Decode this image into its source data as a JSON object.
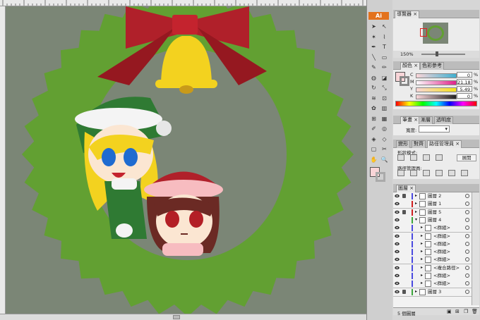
{
  "app": {
    "badge": "Ai"
  },
  "navigator": {
    "tab_label": "導覽器",
    "zoom": "150%"
  },
  "color_panel": {
    "tabs": [
      "顏色",
      "色彩參考"
    ],
    "channels": [
      {
        "label": "C",
        "value": "0",
        "unit": "%"
      },
      {
        "label": "M",
        "value": "21.18",
        "unit": "%"
      },
      {
        "label": "Y",
        "value": "5.49",
        "unit": "%"
      },
      {
        "label": "K",
        "value": "0",
        "unit": "%"
      }
    ],
    "fill_color": "#f9d5d8"
  },
  "stroke_panel": {
    "tabs": [
      "筆畫",
      "漸層",
      "透明度"
    ],
    "width_label": "寬度:"
  },
  "pathfinder_panel": {
    "tabs": [
      "變形",
      "對齊",
      "路徑管理員"
    ],
    "shape_modes_label": "形狀模式:",
    "expand_label": "展開",
    "pathfinders_label": "路徑管理員:"
  },
  "layers_panel": {
    "tab_label": "圖層",
    "footer_count": "5 個圖層",
    "rows": [
      {
        "name": "圖層 2",
        "color": "#4a4ae0",
        "locked": true,
        "indent": 0
      },
      {
        "name": "圖層 1",
        "color": "#d02020",
        "locked": false,
        "indent": 0
      },
      {
        "name": "圖層 5",
        "color": "#d02020",
        "locked": true,
        "indent": 0
      },
      {
        "name": "圖層 4",
        "color": "#3ca63c",
        "locked": false,
        "indent": 0
      },
      {
        "name": "<群組>",
        "color": "#4a4ae0",
        "locked": false,
        "indent": 1
      },
      {
        "name": "<群組>",
        "color": "#4a4ae0",
        "locked": false,
        "indent": 1
      },
      {
        "name": "<群組>",
        "color": "#4a4ae0",
        "locked": false,
        "indent": 1
      },
      {
        "name": "<群組>",
        "color": "#4a4ae0",
        "locked": false,
        "indent": 1
      },
      {
        "name": "<群組>",
        "color": "#4a4ae0",
        "locked": false,
        "indent": 1
      },
      {
        "name": "<複合路徑>",
        "color": "#4a4ae0",
        "locked": false,
        "indent": 1
      },
      {
        "name": "<群組>",
        "color": "#4a4ae0",
        "locked": false,
        "indent": 1
      },
      {
        "name": "<群組>",
        "color": "#4a4ae0",
        "locked": false,
        "indent": 1
      },
      {
        "name": "圖層 3",
        "color": "#3ca63c",
        "locked": true,
        "indent": 0
      }
    ]
  },
  "artwork": {
    "background": "#7b8676",
    "wreath_color": "#62a032",
    "bow_color": "#b0202a",
    "bell_color": "#f3d21f"
  }
}
